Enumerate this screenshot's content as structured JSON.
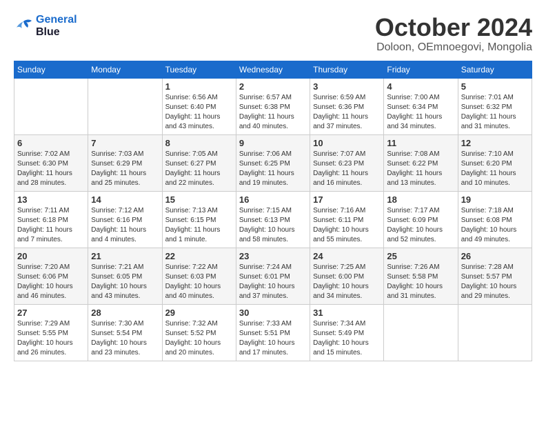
{
  "header": {
    "logo_line1": "General",
    "logo_line2": "Blue",
    "month": "October 2024",
    "location": "Doloon, OEmnoegovi, Mongolia"
  },
  "days_of_week": [
    "Sunday",
    "Monday",
    "Tuesday",
    "Wednesday",
    "Thursday",
    "Friday",
    "Saturday"
  ],
  "weeks": [
    [
      {
        "day": "",
        "info": ""
      },
      {
        "day": "",
        "info": ""
      },
      {
        "day": "1",
        "info": "Sunrise: 6:56 AM\nSunset: 6:40 PM\nDaylight: 11 hours and 43 minutes."
      },
      {
        "day": "2",
        "info": "Sunrise: 6:57 AM\nSunset: 6:38 PM\nDaylight: 11 hours and 40 minutes."
      },
      {
        "day": "3",
        "info": "Sunrise: 6:59 AM\nSunset: 6:36 PM\nDaylight: 11 hours and 37 minutes."
      },
      {
        "day": "4",
        "info": "Sunrise: 7:00 AM\nSunset: 6:34 PM\nDaylight: 11 hours and 34 minutes."
      },
      {
        "day": "5",
        "info": "Sunrise: 7:01 AM\nSunset: 6:32 PM\nDaylight: 11 hours and 31 minutes."
      }
    ],
    [
      {
        "day": "6",
        "info": "Sunrise: 7:02 AM\nSunset: 6:30 PM\nDaylight: 11 hours and 28 minutes."
      },
      {
        "day": "7",
        "info": "Sunrise: 7:03 AM\nSunset: 6:29 PM\nDaylight: 11 hours and 25 minutes."
      },
      {
        "day": "8",
        "info": "Sunrise: 7:05 AM\nSunset: 6:27 PM\nDaylight: 11 hours and 22 minutes."
      },
      {
        "day": "9",
        "info": "Sunrise: 7:06 AM\nSunset: 6:25 PM\nDaylight: 11 hours and 19 minutes."
      },
      {
        "day": "10",
        "info": "Sunrise: 7:07 AM\nSunset: 6:23 PM\nDaylight: 11 hours and 16 minutes."
      },
      {
        "day": "11",
        "info": "Sunrise: 7:08 AM\nSunset: 6:22 PM\nDaylight: 11 hours and 13 minutes."
      },
      {
        "day": "12",
        "info": "Sunrise: 7:10 AM\nSunset: 6:20 PM\nDaylight: 11 hours and 10 minutes."
      }
    ],
    [
      {
        "day": "13",
        "info": "Sunrise: 7:11 AM\nSunset: 6:18 PM\nDaylight: 11 hours and 7 minutes."
      },
      {
        "day": "14",
        "info": "Sunrise: 7:12 AM\nSunset: 6:16 PM\nDaylight: 11 hours and 4 minutes."
      },
      {
        "day": "15",
        "info": "Sunrise: 7:13 AM\nSunset: 6:15 PM\nDaylight: 11 hours and 1 minute."
      },
      {
        "day": "16",
        "info": "Sunrise: 7:15 AM\nSunset: 6:13 PM\nDaylight: 10 hours and 58 minutes."
      },
      {
        "day": "17",
        "info": "Sunrise: 7:16 AM\nSunset: 6:11 PM\nDaylight: 10 hours and 55 minutes."
      },
      {
        "day": "18",
        "info": "Sunrise: 7:17 AM\nSunset: 6:09 PM\nDaylight: 10 hours and 52 minutes."
      },
      {
        "day": "19",
        "info": "Sunrise: 7:18 AM\nSunset: 6:08 PM\nDaylight: 10 hours and 49 minutes."
      }
    ],
    [
      {
        "day": "20",
        "info": "Sunrise: 7:20 AM\nSunset: 6:06 PM\nDaylight: 10 hours and 46 minutes."
      },
      {
        "day": "21",
        "info": "Sunrise: 7:21 AM\nSunset: 6:05 PM\nDaylight: 10 hours and 43 minutes."
      },
      {
        "day": "22",
        "info": "Sunrise: 7:22 AM\nSunset: 6:03 PM\nDaylight: 10 hours and 40 minutes."
      },
      {
        "day": "23",
        "info": "Sunrise: 7:24 AM\nSunset: 6:01 PM\nDaylight: 10 hours and 37 minutes."
      },
      {
        "day": "24",
        "info": "Sunrise: 7:25 AM\nSunset: 6:00 PM\nDaylight: 10 hours and 34 minutes."
      },
      {
        "day": "25",
        "info": "Sunrise: 7:26 AM\nSunset: 5:58 PM\nDaylight: 10 hours and 31 minutes."
      },
      {
        "day": "26",
        "info": "Sunrise: 7:28 AM\nSunset: 5:57 PM\nDaylight: 10 hours and 29 minutes."
      }
    ],
    [
      {
        "day": "27",
        "info": "Sunrise: 7:29 AM\nSunset: 5:55 PM\nDaylight: 10 hours and 26 minutes."
      },
      {
        "day": "28",
        "info": "Sunrise: 7:30 AM\nSunset: 5:54 PM\nDaylight: 10 hours and 23 minutes."
      },
      {
        "day": "29",
        "info": "Sunrise: 7:32 AM\nSunset: 5:52 PM\nDaylight: 10 hours and 20 minutes."
      },
      {
        "day": "30",
        "info": "Sunrise: 7:33 AM\nSunset: 5:51 PM\nDaylight: 10 hours and 17 minutes."
      },
      {
        "day": "31",
        "info": "Sunrise: 7:34 AM\nSunset: 5:49 PM\nDaylight: 10 hours and 15 minutes."
      },
      {
        "day": "",
        "info": ""
      },
      {
        "day": "",
        "info": ""
      }
    ]
  ]
}
